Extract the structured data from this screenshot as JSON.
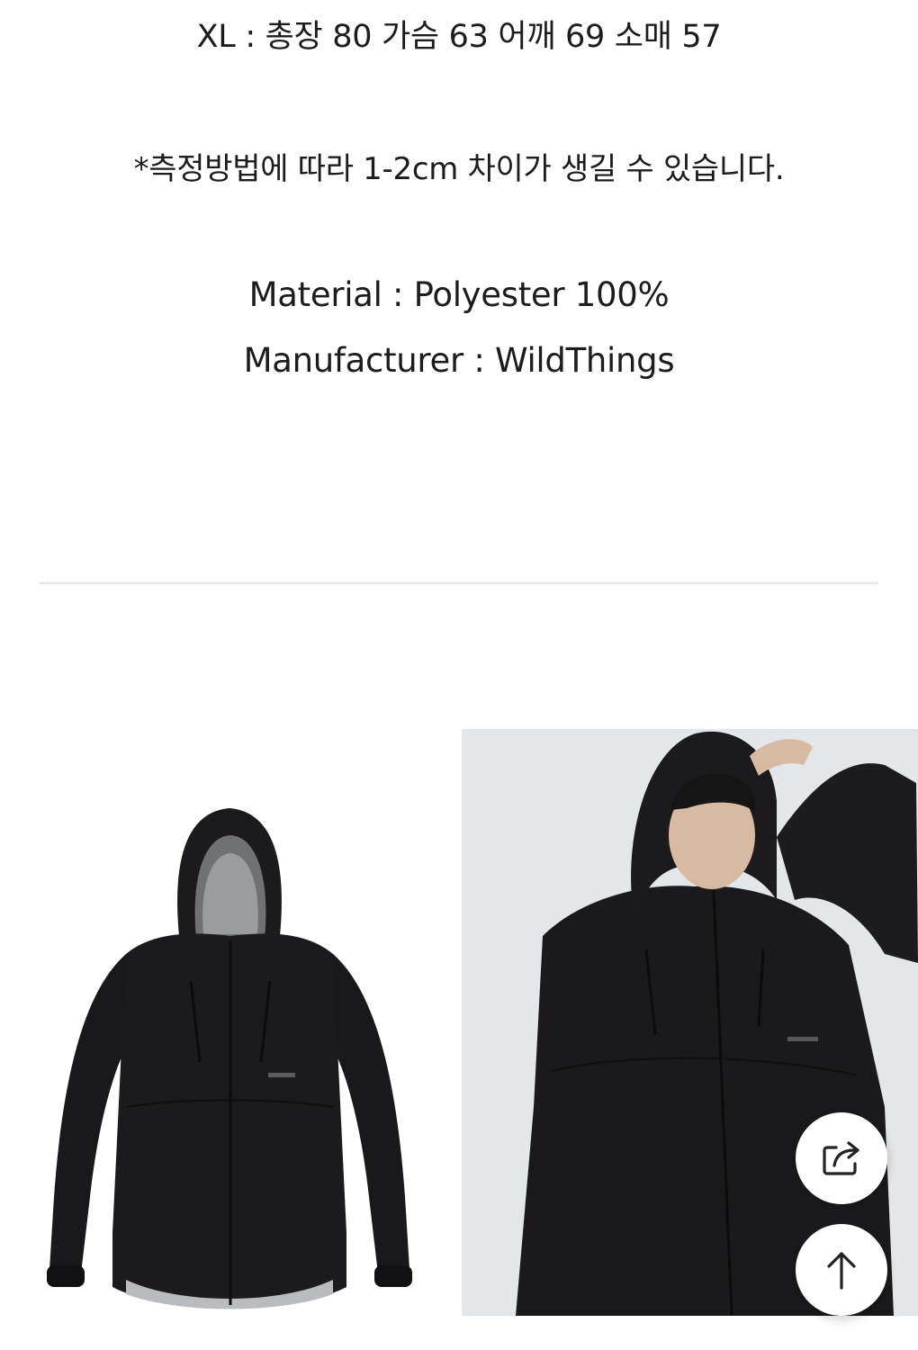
{
  "details": {
    "size_xl": "XL : 총장 80 가슴 63 어깨 69 소매 57",
    "measure_note": "*측정방법에 따라 1-2cm 차이가 생길 수 있습니다.",
    "material": "Material : Polyester 100%",
    "manufacturer": "Manufacturer : WildThings"
  },
  "images": [
    {
      "name": "product-photo",
      "subject": "black hooded shell jacket, flat product shot"
    },
    {
      "name": "model-photo",
      "subject": "model wearing black hooded shell jacket"
    }
  ],
  "floating_buttons": [
    {
      "name": "share-button",
      "icon": "share-icon"
    },
    {
      "name": "scroll-top-button",
      "icon": "arrow-up-icon"
    }
  ],
  "colors": {
    "text": "#1c1c1c",
    "divider": "#e2e2e2",
    "jacket": "#1b1b1d",
    "model_background": "#e4e7e9"
  }
}
